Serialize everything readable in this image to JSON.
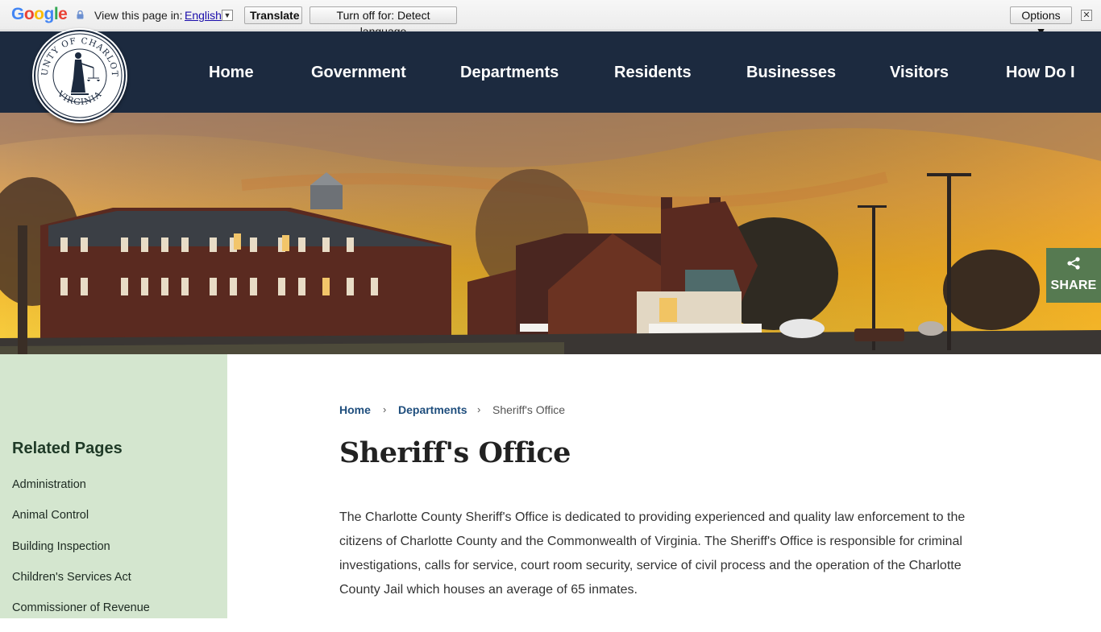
{
  "translate_bar": {
    "logo_letters": [
      "G",
      "o",
      "o",
      "g",
      "l",
      "e"
    ],
    "logo_colors": [
      "#4285f4",
      "#ea4335",
      "#fbbc05",
      "#4285f4",
      "#34a853",
      "#ea4335"
    ],
    "prompt": "View this page in:",
    "language": "English",
    "translate_label": "Translate",
    "turn_off_label": "Turn off for: Detect language",
    "options_label": "Options ▼",
    "close_glyph": "✕"
  },
  "header": {
    "seal": {
      "top_text": "COUNTY OF CHARLOTTE",
      "bottom_text": "VIRGINIA"
    },
    "nav": [
      {
        "label": "Home"
      },
      {
        "label": "Government"
      },
      {
        "label": "Departments"
      },
      {
        "label": "Residents"
      },
      {
        "label": "Businesses"
      },
      {
        "label": "Visitors"
      },
      {
        "label": "How Do I"
      }
    ]
  },
  "share": {
    "label": "SHARE",
    "icon": "share-icon"
  },
  "sidebar": {
    "title": "Related Pages",
    "items": [
      {
        "label": "Administration"
      },
      {
        "label": "Animal Control"
      },
      {
        "label": "Building Inspection"
      },
      {
        "label": "Children's Services Act"
      },
      {
        "label": "Commissioner of Revenue"
      }
    ]
  },
  "breadcrumb": {
    "items": [
      "Home",
      "Departments"
    ],
    "separator": "›",
    "current": "Sheriff's Office"
  },
  "page": {
    "title": "Sheriff's Office",
    "intro": "The Charlotte County Sheriff's Office is dedicated to providing experienced and quality law enforcement to the citizens of Charlotte County and the Commonwealth of Virginia. The Sheriff's Office is responsible for criminal investigations, calls for service, court room security, service of civil process and the operation of the Charlotte County Jail which houses an average of 65 inmates."
  },
  "colors": {
    "header_bg": "#1c2a3f",
    "sidebar_bg": "#d4e6cf",
    "share_bg": "#567a51",
    "link": "#1f4e7d"
  }
}
